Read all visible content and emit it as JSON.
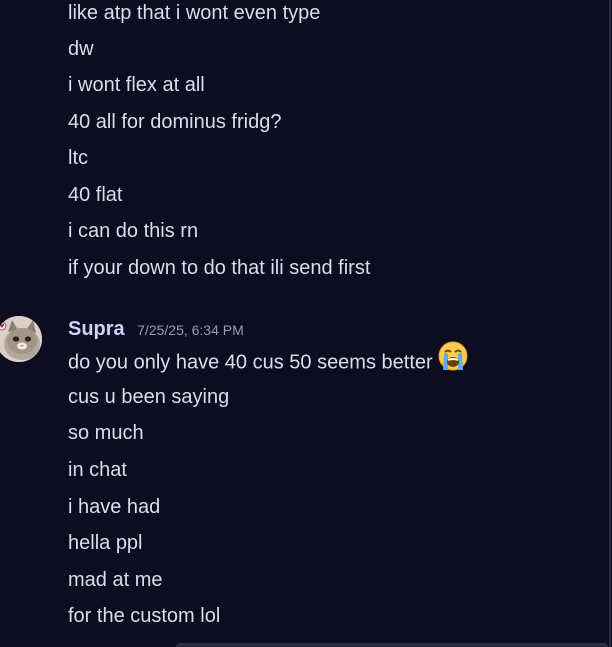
{
  "messages_top": [
    "like atp that i wont even type",
    "dw",
    "i wont flex at all",
    "40 all for dominus fridg?",
    "ltc",
    "40 flat",
    "i can do this rn",
    "if your down to do that  ili send first"
  ],
  "group": {
    "author": "Supra",
    "timestamp": "7/25/25, 6:34 PM",
    "first_line": "do you only have 40 cus 50 seems better",
    "first_line_emoji": "loudly-crying-face-icon",
    "lines": [
      "cus u been saying",
      "so much",
      "in chat",
      "i have had",
      "hella ppl",
      "mad at me",
      "for the custom lol"
    ]
  },
  "colors": {
    "background": "#0d0c20",
    "text": "#dcdde8",
    "author": "#cfd0f5",
    "timestamp": "#9b9cae"
  }
}
